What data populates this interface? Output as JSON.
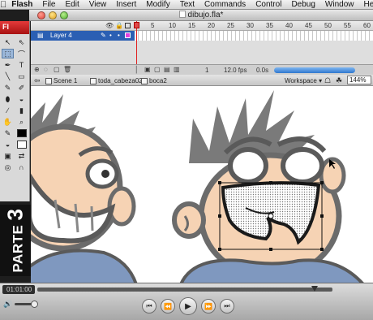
{
  "menubar": {
    "app_name": "Flash",
    "items": [
      "File",
      "Edit",
      "View",
      "Insert",
      "Modify",
      "Text",
      "Commands",
      "Control",
      "Debug",
      "Window",
      "Help"
    ]
  },
  "window": {
    "title": "dibujo.fla*"
  },
  "tools": {
    "header": "Fl"
  },
  "side_tab": {
    "word": "PARTE",
    "number": "3"
  },
  "timeline": {
    "ruler": [
      "1",
      "5",
      "10",
      "15",
      "20",
      "25",
      "30",
      "35",
      "40",
      "45",
      "50",
      "55",
      "60"
    ],
    "layer_name": "Layer 4",
    "current_frame": "1",
    "fps": "12.0 fps",
    "time": "0.0s"
  },
  "editbar": {
    "scene": "Scene 1",
    "symbol_1": "toda_cabeza02",
    "symbol_2": "boca2",
    "workspace": "Workspace ▾",
    "zoom": "144%"
  },
  "player": {
    "timecode": "01:01:00",
    "progress": 0.94
  },
  "colors": {
    "skin": "#f6d3b4",
    "hair": "#7a7a7a",
    "outline": "#5a5a5a",
    "shirt": "#7f98bf",
    "accent_red": "#c8191a",
    "selection": "#1a1a1a"
  }
}
